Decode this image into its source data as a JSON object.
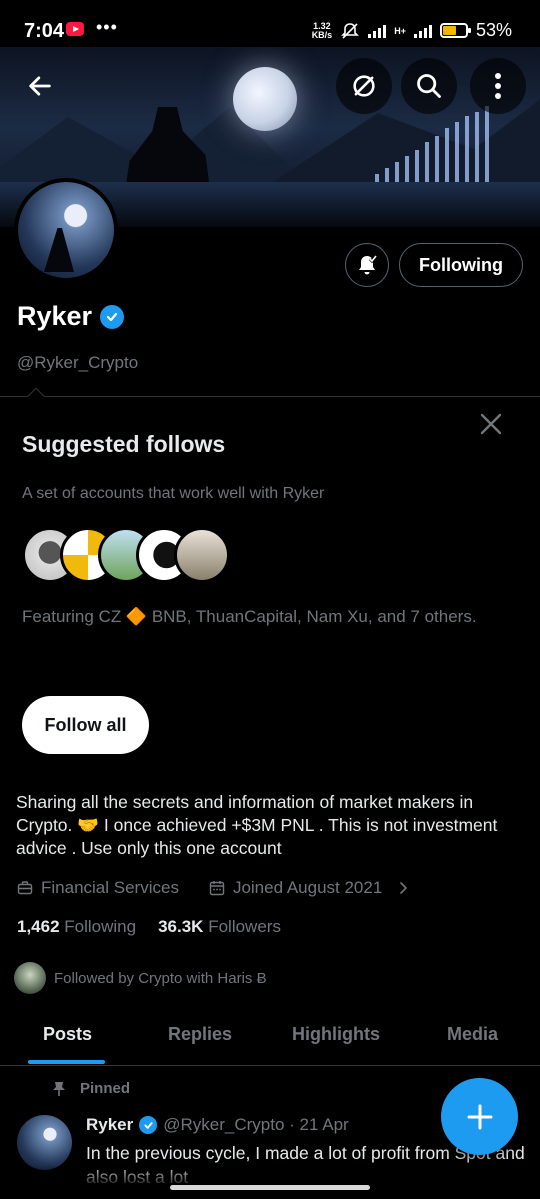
{
  "status_bar": {
    "time": "7:04",
    "dots": "•••",
    "net_speed_value": "1.32",
    "net_speed_unit": "KB/s",
    "network_type": "H+",
    "battery": "53%"
  },
  "profile": {
    "name": "Ryker",
    "handle": "@Ryker_Crypto",
    "following_label": "Following",
    "bio": "Sharing all the secrets and information of market makers in Crypto. 🤝 I once achieved +$3M PNL . This is not investment advice . Use only this one account",
    "category": "Financial Services",
    "joined": "Joined August 2021",
    "following_count": "1,462",
    "following_text": "Following",
    "followers_count": "36.3K",
    "followers_text": "Followers",
    "followed_by": "Followed by Crypto with Haris Ƀ"
  },
  "suggested": {
    "title": "Suggested follows",
    "description": "A set of accounts that work well with Ryker",
    "featuring": "Featuring CZ 🔶 BNB, ThuanCapital, Nam Xu, and 7 others.",
    "follow_all_label": "Follow all"
  },
  "tabs": [
    {
      "label": "Posts"
    },
    {
      "label": "Replies"
    },
    {
      "label": "Highlights"
    },
    {
      "label": "Media"
    }
  ],
  "pinned_post": {
    "pinned_label": "Pinned",
    "author": "Ryker",
    "handle_date": "@Ryker_Crypto · 21 Apr",
    "text": "In the previous cycle, I made a lot of profit from Spot and also lost a lot"
  },
  "colors": {
    "accent": "#1d9bf0",
    "muted": "#71767b",
    "background": "#000000",
    "border": "#2f3336"
  },
  "icons": {
    "back": "arrow-left-icon",
    "grok": "grok-icon",
    "search": "search-icon",
    "more": "more-vertical-icon",
    "bell": "bell-subscribed-icon",
    "close": "close-icon",
    "category": "briefcase-icon",
    "calendar": "calendar-icon",
    "chevron": "chevron-right-icon",
    "pin": "pin-icon",
    "compose": "plus-icon"
  }
}
